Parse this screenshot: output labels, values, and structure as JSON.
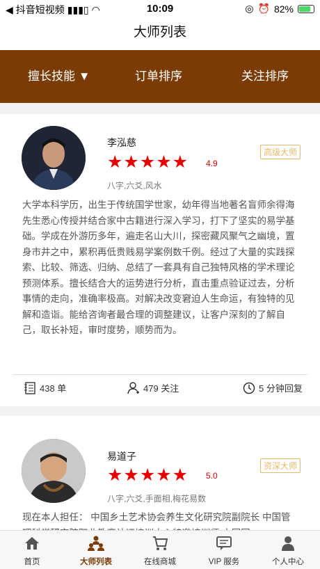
{
  "status": {
    "app": "抖音短视频",
    "time": "10:09",
    "battery": "82%"
  },
  "nav": {
    "title": "大师列表"
  },
  "filters": [
    {
      "label": "擅长技能 ▼"
    },
    {
      "label": "订单排序"
    },
    {
      "label": "关注排序"
    }
  ],
  "masters": [
    {
      "name": "李泓慈",
      "stars": "★★★★★",
      "rating": "4.9",
      "badge": "高级大师",
      "skills": "八字,六爻,风水",
      "bio": "大学本科学历，出生于传统国学世家，幼年得当地著名盲师余得海先生悉心传授并结合家中古籍进行深入学习，打下了坚实的易学基础。学成在外游历多年，遍走名山大川，探密藏风聚气之幽境，置身市井之中，累积再低贵贱易学案例数千例。经过了大量的实践探索、比较、筛选、归纳、总结了一套具有自己独特风格的学术理论预测体系。擅长结合大的运势进行分析，直击重点验证过去，分析事情的走向，准确率极高。对解决改变窘迫人生命运，有独特的见解和造诣。能给咨询者最合理的调整建议，让客户深刻的了解自己，取长补短，审时度势，顺势而为。",
      "orders": "438 单",
      "follows": "479 关注",
      "reply": "5 分钟回复"
    },
    {
      "name": "易道子",
      "stars": "★★★★★",
      "rating": "5.0",
      "badge": "资深大师",
      "skills": "八字,六爻,手面相,梅花易数",
      "bio": "现在本人担任： 中国乡土艺术协会养生文化研究院副院长 中国管理科学研究院职业教育认证培训中心特邀培训师 中国国"
    }
  ],
  "tabs": [
    {
      "label": "首页",
      "icon": "home-icon"
    },
    {
      "label": "大师列表",
      "icon": "masters-icon"
    },
    {
      "label": "在线商城",
      "icon": "shop-icon"
    },
    {
      "label": "VIP 服务",
      "icon": "vip-chat-icon"
    },
    {
      "label": "个人中心",
      "icon": "person-icon"
    }
  ],
  "colors": {
    "brand": "#7a3c04",
    "star": "#e60000",
    "badge": "#e8b86a"
  }
}
